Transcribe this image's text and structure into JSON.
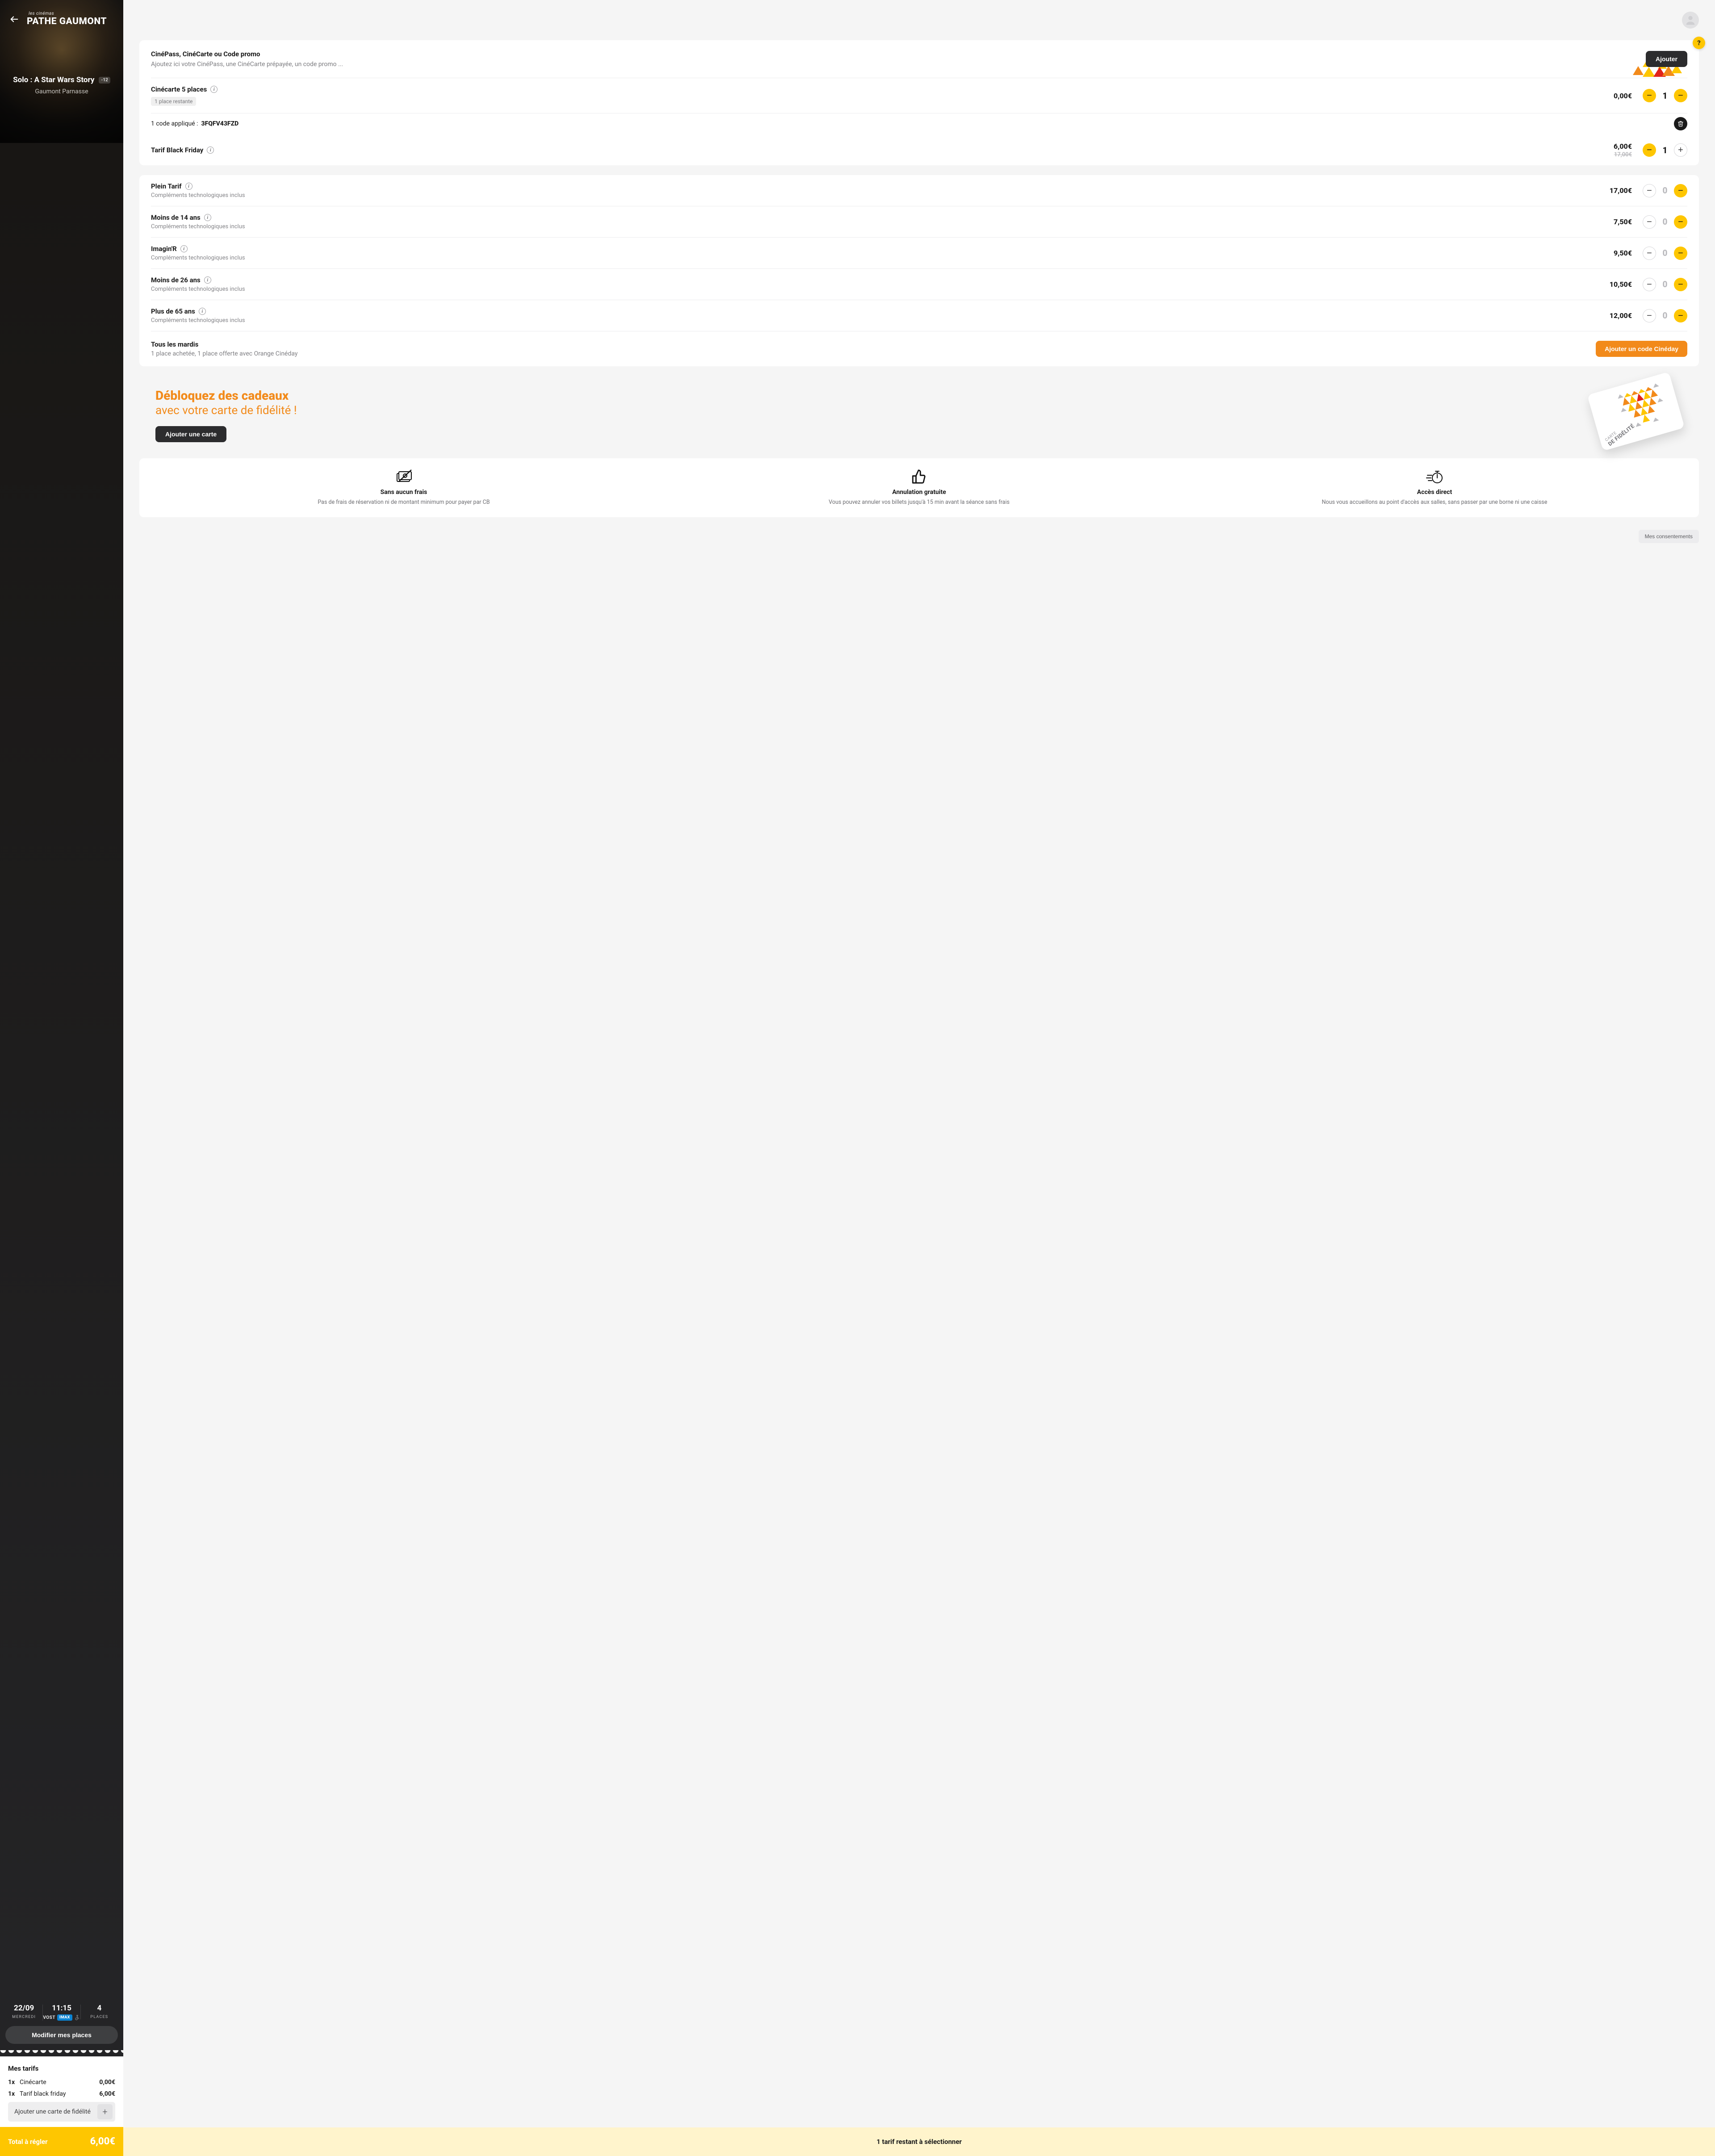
{
  "brand": {
    "kicker": "les cinémas",
    "name": "PATHE GAUMONT"
  },
  "movie": {
    "title": "Solo : A Star Wars Story",
    "age_badge": "-12",
    "cinema": "Gaumont Parnasse"
  },
  "session": {
    "date": "22/09",
    "day": "MERCREDI",
    "time": "11:15",
    "lang": "VOST",
    "format": "IMAX",
    "seats": "4",
    "seats_label": "PLACES",
    "modify": "Modifier mes places"
  },
  "my_rates": {
    "title": "Mes tarifs",
    "items": [
      {
        "qty": "1x",
        "label": "Cinécarte",
        "price": "0,00€"
      },
      {
        "qty": "1x",
        "label": "Tarif black friday",
        "price": "6,00€"
      }
    ],
    "loyalty_add": "Ajouter une carte de fidélité"
  },
  "sidebar_total": {
    "label": "Total à régler",
    "value": "6,00€"
  },
  "promo": {
    "title": "CinéPass, CinéCarte ou Code promo",
    "desc": "Ajoutez ici votre CinéPass, une CinéCarte prépayée, un code promo ...",
    "add": "Ajouter"
  },
  "applied": {
    "cinecarte": {
      "name": "Cinécarte 5 places",
      "price": "0,00€",
      "qty": "1",
      "remaining": "1 place restante"
    },
    "code_row": {
      "prefix": "1 code appliqué :",
      "code": "3FQFV43FZD"
    },
    "blackfriday": {
      "name": "Tarif Black Friday",
      "price": "6,00€",
      "old": "17,00€",
      "qty": "1"
    }
  },
  "rates": [
    {
      "name": "Plein Tarif",
      "sub": "Compléments technologiques inclus",
      "price": "17,00€",
      "qty": "0"
    },
    {
      "name": "Moins de 14 ans",
      "sub": "Compléments technologiques inclus",
      "price": "7,50€",
      "qty": "0"
    },
    {
      "name": "Imagin'R",
      "sub": "Compléments technologiques inclus",
      "price": "9,50€",
      "qty": "0"
    },
    {
      "name": "Moins de 26 ans",
      "sub": "Compléments technologiques inclus",
      "price": "10,50€",
      "qty": "0"
    },
    {
      "name": "Plus de 65 ans",
      "sub": "Compléments technologiques inclus",
      "price": "12,00€",
      "qty": "0"
    }
  ],
  "cineday": {
    "title": "Tous les mardis",
    "desc": "1 place achetée, 1 place offerte avec Orange Cinéday",
    "btn": "Ajouter un code Cinéday"
  },
  "gifts": {
    "h1": "Débloquez des cadeaux",
    "h2": "avec votre carte de fidélité !",
    "btn": "Ajouter une carte",
    "card_kicker": "CARTE",
    "card_main": "DE FIDÉLITÉ"
  },
  "benefits": [
    {
      "title": "Sans aucun frais",
      "desc": "Pas de frais de réservation ni de montant minimum pour payer par CB"
    },
    {
      "title": "Annulation gratuite",
      "desc": "Vous pouvez annuler vos billets jusqu'à 15 min avant la séance sans frais"
    },
    {
      "title": "Accès direct",
      "desc": "Nous vous accueillons au point d'accès aux salles, sans passer par une borne ni une caisse"
    }
  ],
  "consent": "Mes consentements",
  "main_footer": "1 tarif restant à sélectionner",
  "help": "?"
}
